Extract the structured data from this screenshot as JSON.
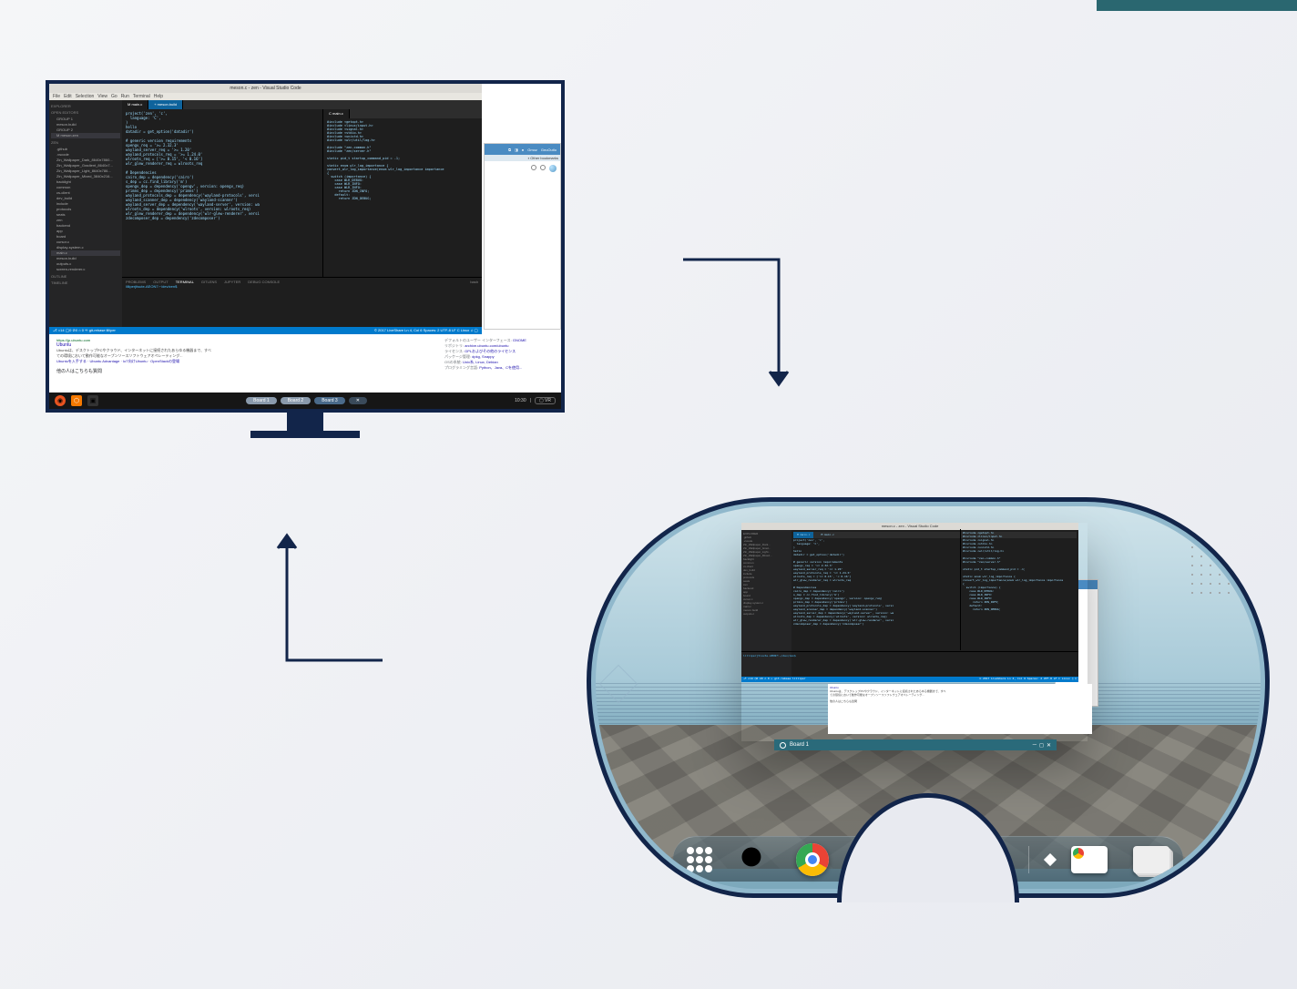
{
  "monitor": {
    "vscode": {
      "title": "meson.c - zen - Visual Studio Code",
      "menu": [
        "File",
        "Edit",
        "Selection",
        "View",
        "Go",
        "Run",
        "Terminal",
        "Help"
      ],
      "explorer_label": "EXPLORER",
      "open_editors_label": "OPEN EDITORS",
      "groups": [
        "GROUP 1",
        "GROUP 2"
      ],
      "open_files": [
        "meson.build",
        "M meson.zen"
      ],
      "workspace_label": "ZEN",
      "tree": [
        ".github",
        ".vscode",
        "Zin_Wallpaper_Dark_8640x7860...",
        "Zin_Wallpaper_Gradient_8640x7...",
        "Zin_Wallpaper_Light_8640x786...",
        "Zin_Wallpaper_Mixed_3840x216...",
        "backlight",
        "common",
        "cs-client",
        "dev_build",
        "include",
        "protocols",
        "seats",
        "zen",
        "backend",
        "app",
        "board",
        "cursor.c",
        "display-system.c",
        "main.c",
        "meson.build",
        "outputs.c",
        "screen-renderer.c"
      ],
      "outline_label": "OUTLINE",
      "timeline_label": "TIMELINE",
      "tabs_left": [
        "M main.c",
        "+ meson.build"
      ],
      "tabs_right": [
        "C main.c"
      ],
      "code_left": "project('zen', 'c',\n  language: 'C',\n)\nhello\ndatadir = get_option('datadir')\n\n# generic version requirements\nopengv_req = '>= 2.32.3'\nwayland_server_req = '>= 1.20'\nwayland_protocols_req = '>= 1.24.0'\nwlroots_req = ['>= 0.15', '< 0.16']\nwlr_glew_renderer_req = wlroots_req\n\n# Dependencies\ncairo_dep = dependency('cairo')\ns_dep = cc.find_library('m')\nopengv_dep = dependency('opengv', version: opengv_req)\nprimns_dep = dependency('primns')\nwayland_protocols_dep = dependency('wayland-protocols', versi\nwayland_scanner_dep = dependency('wayland-scanner')\nwayland_server_dep = dependency('wayland-server', version: wa\nwlroots_dep = dependency('wlroots', version: wlroots_req)\nwlr_glew_renderer_dep = dependency('wlr-glew-renderer', versi\nzdecomposer_dep = dependency('zdecomposer')",
      "code_right": "#include <getopt.h>\n#include <linux/input.h>\n#include <signal.h>\n#include <stdio.h>\n#include <unistd.h>\n#include <wlr/util/log.h>\n\n#include \"zen-common.h\"\n#include \"zen/server.h\"\n\nstatic pid_t startup_command_pid = -1;\n\nstatic enum wlr_log_importance {\nconvert_wlr_log_importance(enum wlr_log_importance importance\n{\n  switch (importance) {\n    case WLR_DEBUG:\n    case WLR_INFO:\n    case WLR_INFO:\n      return ZDN_INFO;\n    default:\n      return ZDN_DEBUG;",
      "terminal": {
        "tabs": [
          "PROBLEMS",
          "OUTPUT",
          "TERMINAL",
          "GITLENS",
          "JUPYTER",
          "DEBUG CONSOLE"
        ],
        "right_label": "bash",
        "prompt": "lilliperjtisute-AEON7:~/dev/zen$"
      },
      "statusbar": {
        "left": "⎇ ⌂14 ◯0 ⊘0 ⌂ 0  ♾ git-rebase  lilliper",
        "right": "© 2017 LiveShare  Ln 4, Col 6  Spaces: 2  UTF-8  LF  C  Linux  ♫ ◯"
      }
    },
    "browser_behind": {
      "toolbar_icons": [
        "⧉",
        "◨",
        "◑",
        "Gmoz",
        "GnuOutlo"
      ],
      "bookmark": "▪ Other bookmarks"
    },
    "web": {
      "url": "https://jp.ubuntu.com",
      "title": "Ubuntu",
      "desc1": "Ubuntuは、デスクトップPCやクラウド、インターネットに接続されたあらゆる機器まで、すべ",
      "desc2": "ての環境において動作可能なオープンソースソフトウェアオペレーティング...",
      "desc3": "Ubuntuを入手する · Ubuntu Advantage · IoT向けUbuntu · OpenStackの登場",
      "related": "他の人はこちらも質問",
      "kg": [
        {
          "k": "デフォルトのユーザー インターフェース:",
          "v": "GNOME"
        },
        {
          "k": "リポジトリ:",
          "v": "archive.ubuntu.com/ubuntu"
        },
        {
          "k": "ライセンス:",
          "v": "GPLおよびその他のライセンス"
        },
        {
          "k": "パッケージ管理:",
          "v": "dpkg, Snappy"
        },
        {
          "k": "OSの系統:",
          "v": "Unix系, Linux, Debian"
        },
        {
          "k": "プログラミング言語:",
          "v": "Python、Java、Cを使用..."
        }
      ]
    },
    "taskbar": {
      "boards": [
        "Board 1",
        "Board 2",
        "Board 3"
      ],
      "time": "10:30",
      "vr": "▢ VR"
    }
  },
  "vr": {
    "board_title": "Board 1",
    "dock_icons": [
      "apps",
      "search",
      "chrome",
      "files",
      "spotify",
      "cube"
    ]
  }
}
